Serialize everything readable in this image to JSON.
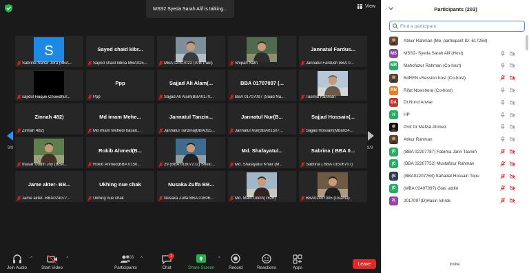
{
  "meeting": {
    "talking_banner": "MSS2  Syeda Sarah Alif is talking...",
    "view_label": "View",
    "page_indicator_left": "9/9",
    "page_indicator_right": "9/9"
  },
  "tiles": [
    {
      "big": "",
      "foot": "Sabrina Nahar Jora (BBA...",
      "kind": "avatar-s"
    },
    {
      "big": "Sayed shaid kibr...",
      "foot": "Sayed shaid kibria MBA025...",
      "kind": "name"
    },
    {
      "big": "",
      "foot": "MBA 02407022 (Arik Paul)",
      "kind": "photo"
    },
    {
      "big": "",
      "foot": "Shipan Nath",
      "kind": "photo"
    },
    {
      "big": "Jannatul Fardus...",
      "foot": "Jannatul Fardush  BBA 0...",
      "kind": "name"
    },
    {
      "big": "",
      "foot": "sajidul Haque Chowdhur...",
      "kind": "black"
    },
    {
      "big": "Ppp",
      "foot": "Ppp",
      "kind": "name"
    },
    {
      "big": "Sajjad Ali Alam(...",
      "foot": "Sajjad Ali Alam(BBA0170...",
      "kind": "name"
    },
    {
      "big": "BBA 01707097 (...",
      "foot": "BBA 01707097 (Saad Na...",
      "kind": "name"
    },
    {
      "big": "",
      "foot": "Tasmia Rahman",
      "kind": "photo"
    },
    {
      "big": "Zinnah 482)",
      "foot": "Zinnah 482)",
      "kind": "name"
    },
    {
      "big": "Md imam Mehe...",
      "foot": "Md imam Mehedi hasan...",
      "kind": "name"
    },
    {
      "big": "Jannatul Tanzin...",
      "foot": "Jannatul Tanzina(BBA015...",
      "kind": "name"
    },
    {
      "big": "Jannatul Nur(B...",
      "foot": "Jannatul Nur(BBA01507...",
      "kind": "name"
    },
    {
      "big": "Sajjad Hossain(...",
      "foot": "Sajjad Hossain(Mba024...",
      "kind": "name"
    },
    {
      "big": "",
      "foot": "Ittasar Uddin Joy  (BBA...",
      "kind": "photo"
    },
    {
      "big": "Rokib Ahmed(B...",
      "foot": "Rokib Ahmed(BBA 0150...",
      "kind": "name"
    },
    {
      "big": "",
      "foot": "29 (BBA 01807272) Sheic...",
      "kind": "photo"
    },
    {
      "big": "Md. Shafayatul...",
      "foot": "Md. Shafayatul Khair (M...",
      "kind": "name"
    },
    {
      "big": "Sabrina ( BBA 0...",
      "foot": "Sabrina ( BBA 01506707)",
      "kind": "name"
    },
    {
      "big": "Jame akter- BB...",
      "foot": "Jame akter- BBA024077...",
      "kind": "name"
    },
    {
      "big": "Ukhing nue chak",
      "foot": "Ukhing nue chak",
      "kind": "name"
    },
    {
      "big": "Nusaka Zulfa BB...",
      "foot": "Nusaka Zulfa BBA 01606...",
      "kind": "name"
    },
    {
      "big": "",
      "foot": "Md. Main Uddin(7826)",
      "kind": "photo"
    },
    {
      "big": "",
      "foot": "BBA02407005 (Osama)",
      "kind": "photo"
    }
  ],
  "toolbar": {
    "join_audio": "Join Audio",
    "start_video": "Start Video",
    "participants": "Participants",
    "participants_count": "203",
    "chat": "Chat",
    "chat_badge": "1",
    "share_screen": "Share Screen",
    "record": "Record",
    "reactions": "Reactions",
    "apps": "Apps",
    "leave": "Leave"
  },
  "panel": {
    "title": "Participants (203)",
    "search_placeholder": "Find a participant",
    "invite": "Invite",
    "participants": [
      {
        "name": "Atikur Rahman (Me, participant ID: 617258)",
        "avatar": "",
        "color": "#6b4a2e",
        "mic": "none",
        "video": "none"
      },
      {
        "name": "MSS2- Syeda Sarah Alif (Host)",
        "avatar": "MS",
        "color": "#8e44ad",
        "mic": "on",
        "video": "off-gray"
      },
      {
        "name": "Mahofuzur Rahman (Co-host)",
        "avatar": "MR",
        "color": "#27ae60",
        "mic": "on",
        "video": "off-gray"
      },
      {
        "name": "BdREN vSession host (Co-host)",
        "avatar": "",
        "color": "#5a4636",
        "mic": "muted",
        "video": "off"
      },
      {
        "name": "Rifat Nowshera (Co-host)",
        "avatar": "RN",
        "color": "#e67e22",
        "mic": "on",
        "video": "off-gray"
      },
      {
        "name": "Dr.Nurul Anwar",
        "avatar": "DA",
        "color": "#c0392b",
        "mic": "on",
        "video": "off-gray"
      },
      {
        "name": "HP",
        "avatar": "H",
        "color": "#27ae60",
        "mic": "on",
        "video": "off-gray"
      },
      {
        "name": "Prof Dr Mafzal Ahmed",
        "avatar": "",
        "color": "#111111",
        "mic": "on",
        "video": "off-gray"
      },
      {
        "name": "Atikur Rahman",
        "avatar": "",
        "color": "#5e4631",
        "mic": "on",
        "video": "off-gray"
      },
      {
        "name": "(BBA 02207787) Fatema Jarin Tasnim",
        "avatar": "(0",
        "color": "#27ae60",
        "mic": "muted",
        "video": "off"
      },
      {
        "name": "(BBA 02207752) Mustafizur Rahman",
        "avatar": "(0",
        "color": "#27ae60",
        "mic": "muted",
        "video": "off"
      },
      {
        "name": "(BBA02207764) Sahadat Hossain Topu",
        "avatar": "(S",
        "color": "#2c3e50",
        "mic": "muted",
        "video": "off"
      },
      {
        "name": "(MBA 02407097) Gias uddin",
        "avatar": "(0",
        "color": "#27ae60",
        "mic": "muted",
        "video": "off"
      },
      {
        "name": "2017097(D)Hasin Ishrak",
        "avatar": "2(",
        "color": "#8e44ad",
        "mic": "muted",
        "video": "off"
      }
    ]
  }
}
